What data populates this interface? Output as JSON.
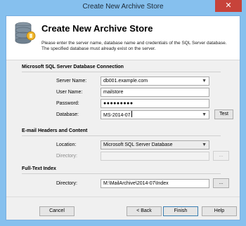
{
  "window": {
    "title": "Create New Archive Store",
    "close_glyph": "✕"
  },
  "header": {
    "icon": "database-icon",
    "heading": "Create New Archive Store",
    "description_line1": "Please enter the server name, database name and credentials of the SQL Server database.",
    "description_line2": "The specified database must already exist on the server."
  },
  "sql_section": {
    "title": "Microsoft SQL Server Database Connection",
    "server_label": "Server Name:",
    "server_value": "db001.example.com",
    "user_label": "User Name:",
    "user_value": "mailstore",
    "password_label": "Password:",
    "password_value": "●●●●●●●●●",
    "database_label": "Database:",
    "database_value": "MS-2014-07",
    "test_label": "Test"
  },
  "email_section": {
    "title": "E-mail Headers and Content",
    "location_label": "Location:",
    "location_value": "Microsoft SQL Server Database",
    "directory_label": "Directory:",
    "directory_value": "",
    "browse_label": "..."
  },
  "fulltext_section": {
    "title": "Full-Text Index",
    "directory_label": "Directory:",
    "directory_value": "M:\\MailArchive\\2014-07\\Index",
    "browse_label": "..."
  },
  "footer": {
    "cancel": "Cancel",
    "back": "< Back",
    "finish": "Finish",
    "help": "Help"
  }
}
